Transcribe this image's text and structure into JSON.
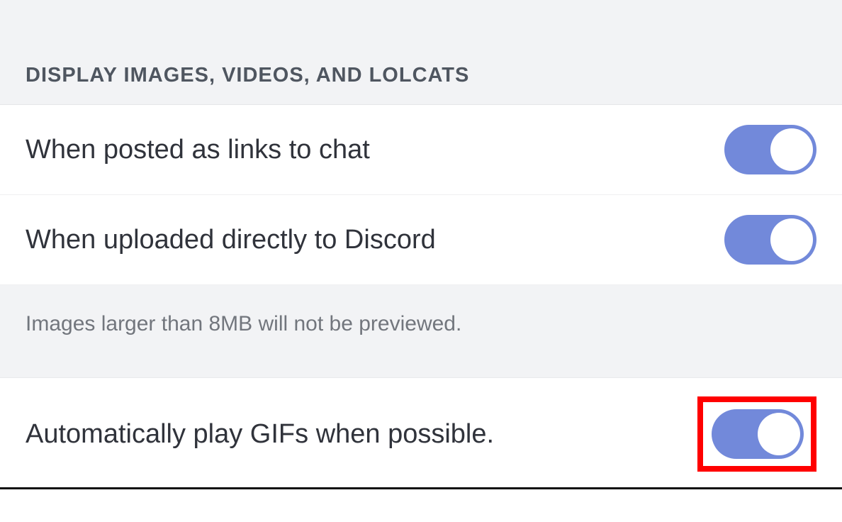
{
  "section": {
    "header": "DISPLAY IMAGES, VIDEOS, AND LOLCATS",
    "settings": [
      {
        "label": "When posted as links to chat",
        "enabled": true
      },
      {
        "label": "When uploaded directly to Discord",
        "enabled": true
      }
    ],
    "note": "Images larger than 8MB will not be previewed.",
    "gif_setting": {
      "label": "Automatically play GIFs when possible.",
      "enabled": true
    }
  }
}
